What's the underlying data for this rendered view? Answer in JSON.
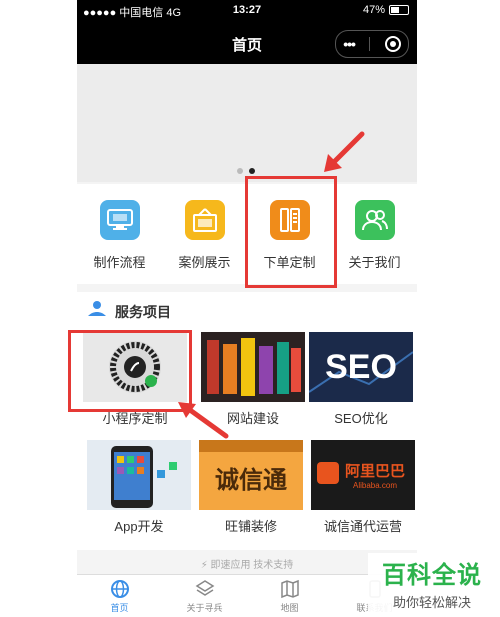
{
  "status_bar": {
    "carrier": "●●●●● 中国电信  4G",
    "time": "13:27",
    "battery": "47%"
  },
  "nav": {
    "title": "首页",
    "more_glyph": "•••"
  },
  "banner": {
    "active_dot": 2,
    "dot_count": 2
  },
  "quick_menu": [
    {
      "label": "制作流程",
      "icon": "monitor-icon",
      "color": "#4fb0e8"
    },
    {
      "label": "案例展示",
      "icon": "picture-frame-icon",
      "color": "#f6b81c"
    },
    {
      "label": "下单定制",
      "icon": "order-form-icon",
      "color": "#f08c1a"
    },
    {
      "label": "关于我们",
      "icon": "users-icon",
      "color": "#3cc15c"
    }
  ],
  "services": {
    "title": "服务项目",
    "items": [
      {
        "caption": "小程序定制",
        "thumb": "mini-program-code"
      },
      {
        "caption": "网站建设",
        "thumb": "website-collage"
      },
      {
        "caption": "SEO优化",
        "thumb": "seo-graphic",
        "thumb_text": "SEO"
      },
      {
        "caption": "App开发",
        "thumb": "phone-apps"
      },
      {
        "caption": "旺铺装修",
        "thumb": "shop-banner",
        "thumb_text": "诚信通"
      },
      {
        "caption": "诚信通代运营",
        "thumb": "alibaba-logo",
        "thumb_text": "阿里巴巴",
        "thumb_sub": "Alibaba.com"
      }
    ]
  },
  "support_text": "即速应用 技术支持",
  "tabs": [
    {
      "label": "首页",
      "icon": "globe-icon",
      "active": true
    },
    {
      "label": "关于寻兵",
      "icon": "layers-icon",
      "active": false
    },
    {
      "label": "地图",
      "icon": "map-icon",
      "active": false
    },
    {
      "label": "联系我们",
      "icon": "phone-icon",
      "active": false
    }
  ],
  "watermark": {
    "title": "百科全说",
    "subtitle": "助你轻松解决"
  },
  "colors": {
    "annotation_red": "#e53935",
    "tab_active": "#3a8ee6",
    "watermark_green": "#2bb24c"
  }
}
